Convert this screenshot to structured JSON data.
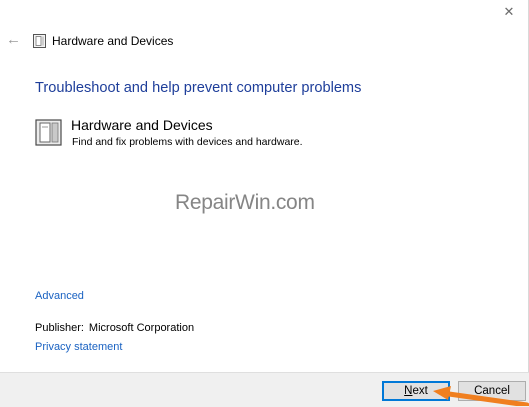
{
  "window": {
    "close_glyph": "✕",
    "back_glyph": "←",
    "header_title": "Hardware and Devices"
  },
  "main": {
    "heading": "Troubleshoot and help prevent computer problems",
    "item": {
      "title": "Hardware and Devices",
      "description": "Find and fix problems with devices and hardware."
    },
    "watermark": "RepairWin.com",
    "advanced_link": "Advanced",
    "publisher_label": "Publisher:",
    "publisher_value": "Microsoft Corporation",
    "privacy_link": "Privacy statement"
  },
  "footer": {
    "next_access_key": "N",
    "next_rest": "ext",
    "cancel_label": "Cancel"
  },
  "colors": {
    "heading": "#1e3e9a",
    "link": "#1a62c2",
    "focus_border": "#0078d7",
    "annotation_arrow": "#f07f1f"
  }
}
